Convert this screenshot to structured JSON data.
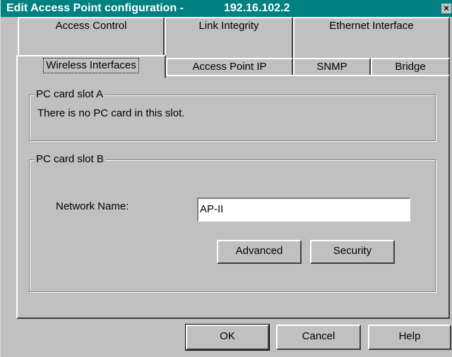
{
  "window": {
    "title": "Edit Access Point configuration -",
    "title_ip": "192.16.102.2",
    "close_glyph": "×"
  },
  "tabs": {
    "row1": [
      "Access Control",
      "Link Integrity",
      "Ethernet Interface"
    ],
    "row2": [
      "Wireless Interfaces",
      "Access Point IP",
      "SNMP",
      "Bridge"
    ],
    "active": "Wireless Interfaces"
  },
  "slot_a": {
    "legend": "PC card slot A",
    "message": "There is no PC card in this slot."
  },
  "slot_b": {
    "legend": "PC card slot B",
    "network_name_label": "Network Name:",
    "network_name_value": "AP-II",
    "advanced_label": "Advanced",
    "security_label": "Security"
  },
  "footer": {
    "ok_label": "OK",
    "cancel_label": "Cancel",
    "help_label": "Help"
  },
  "colors": {
    "titlebar": "#008080",
    "face": "#c0c0c0"
  }
}
